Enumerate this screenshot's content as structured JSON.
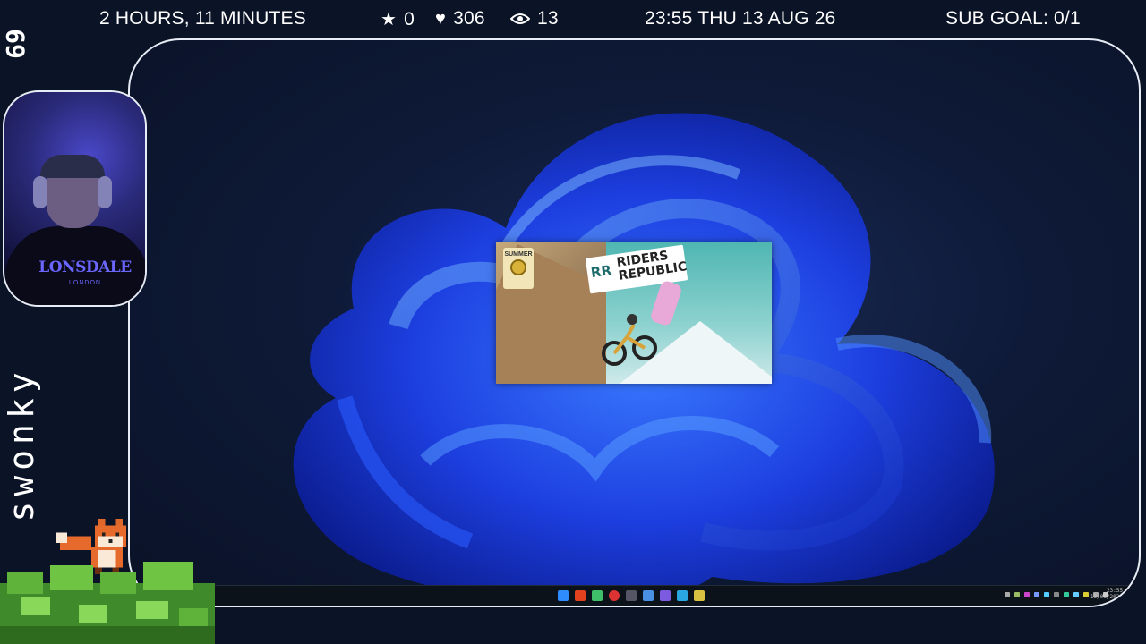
{
  "stream_overlay": {
    "uptime": "2 HOURS, 11 MINUTES",
    "followers": {
      "icon": "star-icon",
      "value": "0"
    },
    "likes": {
      "icon": "heart-icon",
      "value": "306"
    },
    "viewers": {
      "icon": "eye-icon",
      "value": "13"
    },
    "datetime": "23:55 THU 13 AUG 26",
    "sub_goal": "SUB GOAL: 0/1",
    "channel_name": "swonky",
    "channel_tag": "69"
  },
  "webcam": {
    "shirt_brand": "LONSDALE",
    "shirt_sub": "LONDON"
  },
  "game_splash": {
    "title": "RIDERS REPUBLIC",
    "badge": "SUMMER",
    "logo_mark": "RR"
  },
  "taskbar": {
    "clock_time": "23:55",
    "clock_date": "13/08/2026"
  },
  "colors": {
    "wallpaper_accent": "#1f4fff",
    "frame_border": "#e8ecf5",
    "brand_text": "#6b66ff"
  }
}
